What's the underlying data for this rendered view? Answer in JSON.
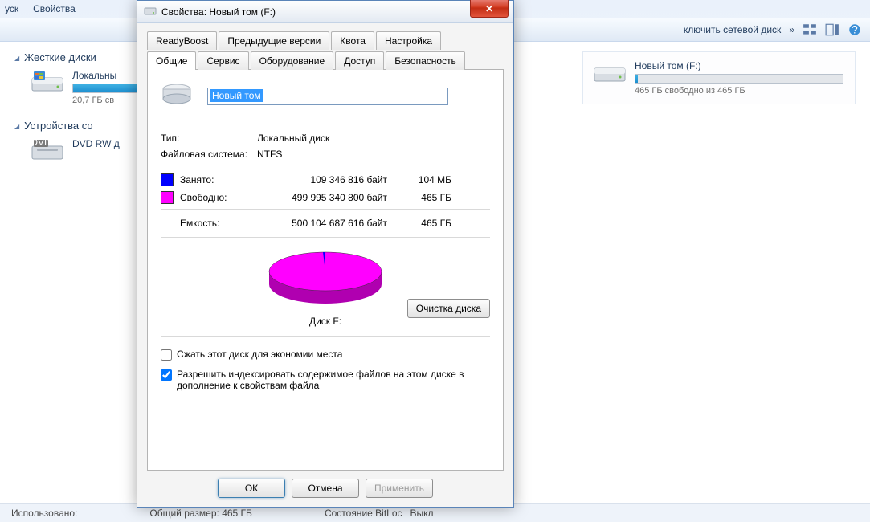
{
  "explorer": {
    "menu": {
      "start": "уск",
      "props": "Свойства"
    },
    "toolbar": {
      "map": "ключить сетевой диск",
      "more": "»"
    },
    "sections": {
      "hdd_title": "Жесткие диски",
      "removable_title": "Устройства со"
    },
    "drives": {
      "c": {
        "name": "Локальны",
        "free": "20,7 ГБ св"
      },
      "dvd": {
        "name": "DVD RW д"
      },
      "f": {
        "name": "Новый том (F:)",
        "free": "465 ГБ свободно из 465 ГБ"
      }
    },
    "status": {
      "used_label": "Использовано:",
      "total_label": "Общий размер:",
      "total_value": "465 ГБ",
      "bitloc_label": "Состояние BitLoc",
      "bitloc_value": "Выкл"
    }
  },
  "dialog": {
    "title": "Свойства: Новый том (F:)",
    "tabs_row1": [
      "ReadyBoost",
      "Предыдущие версии",
      "Квота",
      "Настройка"
    ],
    "tabs_row2": [
      "Общие",
      "Сервис",
      "Оборудование",
      "Доступ",
      "Безопасность"
    ],
    "active_tab": "Общие",
    "volume_name": "Новый том",
    "type_label": "Тип:",
    "type_value": "Локальный диск",
    "fs_label": "Файловая система:",
    "fs_value": "NTFS",
    "used_label": "Занято:",
    "used_bytes": "109 346 816 байт",
    "used_hum": "104 МБ",
    "free_label": "Свободно:",
    "free_bytes": "499 995 340 800 байт",
    "free_hum": "465 ГБ",
    "cap_label": "Емкость:",
    "cap_bytes": "500 104 687 616 байт",
    "cap_hum": "465 ГБ",
    "disk_label": "Диск F:",
    "clean_btn": "Очистка диска",
    "compress_label": "Сжать этот диск для экономии места",
    "index_label": "Разрешить индексировать содержимое файлов на этом диске в дополнение к свойствам файла",
    "buttons": {
      "ok": "ОК",
      "cancel": "Отмена",
      "apply": "Применить"
    },
    "colors": {
      "used": "#0000ff",
      "free": "#ff00ff"
    }
  },
  "chart_data": {
    "type": "pie",
    "title": "Диск F:",
    "series": [
      {
        "name": "Занято",
        "value": 109346816,
        "color": "#0000ff"
      },
      {
        "name": "Свободно",
        "value": 499995340800,
        "color": "#ff00ff"
      }
    ]
  }
}
